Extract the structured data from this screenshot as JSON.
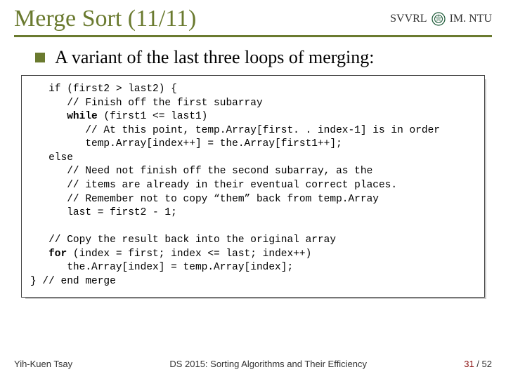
{
  "header": {
    "title": "Merge Sort (11/11)",
    "lab": "SVVRL",
    "at": "@",
    "org": "IM. NTU"
  },
  "bullet": {
    "text": "A variant of the last three loops of merging:"
  },
  "code": {
    "l01a": "   if (first2 > last2) {",
    "l02a": "      // Finish off the first subarray",
    "l03a": "      ",
    "l03b": "while",
    "l03c": " (first1 <= last1)",
    "l04a": "         // At this point, temp.Array[first. . index-1] is in order",
    "l05a": "         temp.Array[index++] = the.Array[first1++];",
    "l06a": "   else",
    "l07a": "      // Need not finish off the second subarray, as the",
    "l08a": "      // items are already in their eventual correct places.",
    "l09a": "      // Remember not to copy “them” back from temp.Array",
    "l10a": "      last = first2 - 1;",
    "blank": "",
    "l11a": "   // Copy the result back into the original array",
    "l12a": "   ",
    "l12b": "for",
    "l12c": " (index = first; index <= last; index++)",
    "l13a": "      the.Array[index] = temp.Array[index];",
    "l14a": "} // end merge"
  },
  "footer": {
    "author": "Yih-Kuen Tsay",
    "course": "DS 2015: Sorting Algorithms and Their Efficiency",
    "page_current": "31",
    "page_sep": " / ",
    "page_total": "52"
  }
}
